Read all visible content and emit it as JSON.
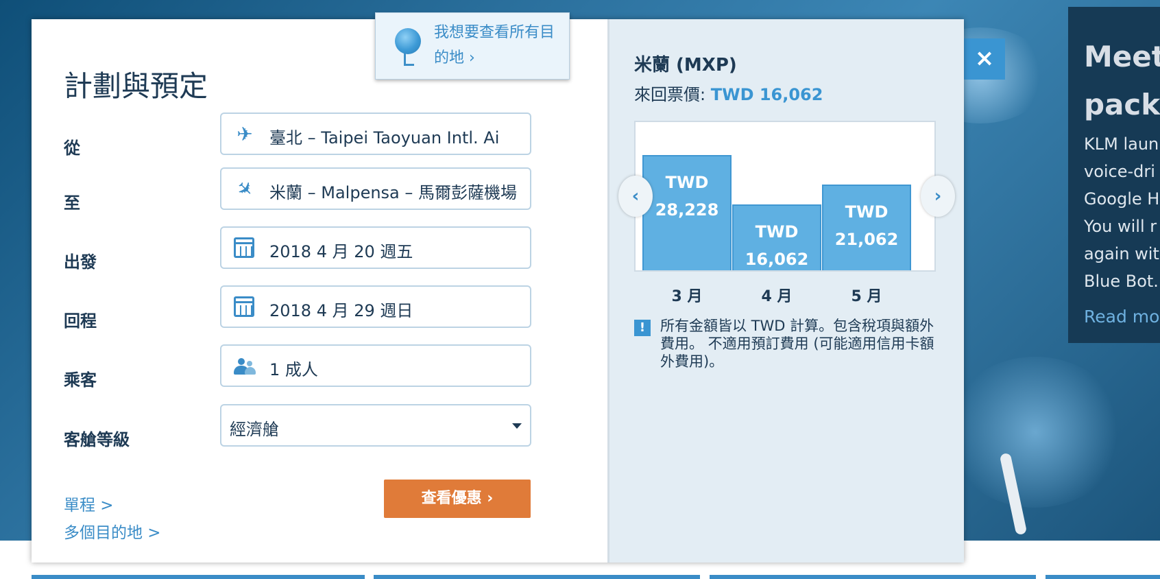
{
  "dialog": {
    "title": "計劃與預定",
    "destination_bubble": {
      "text": "我想要查看所有目的地 ›"
    },
    "fields": {
      "from": {
        "label": "從",
        "value": "臺北 – Taipei Taoyuan Intl. Ai",
        "icon": "plane-departure-icon"
      },
      "to": {
        "label": "至",
        "value": "米蘭 – Malpensa – 馬爾彭薩機場",
        "icon": "plane-arrival-icon"
      },
      "depart": {
        "label": "出發",
        "value": "2018 4 月 20 週五",
        "icon": "calendar-icon"
      },
      "return": {
        "label": "回程",
        "value": "2018 4 月 29 週日",
        "icon": "calendar-icon"
      },
      "passengers": {
        "label": "乘客",
        "value": "1 成人",
        "icon": "passengers-icon"
      },
      "cabin": {
        "label": "客艙等級",
        "value": "經濟艙"
      }
    },
    "links": {
      "one_way": "單程 >",
      "multi_city": "多個目的地 >"
    },
    "cta": "查看優惠 ›",
    "close": "×"
  },
  "fare_panel": {
    "city": "米蘭 (MXP)",
    "fare_label": "來回票價: ",
    "fare_amount": "TWD 16,062",
    "note": "所有金額皆以 TWD 計算。包含稅項與額外費用。 不適用預訂費用 (可能適用信用卡額外費用)。",
    "info_icon": "!",
    "nav_prev": "‹",
    "nav_next": "›"
  },
  "chart_data": {
    "type": "bar",
    "categories": [
      "3 月",
      "4 月",
      "5 月"
    ],
    "values": [
      28228,
      16062,
      21062
    ],
    "labels": [
      "TWD 28,228",
      "TWD 16,062",
      "TWD 21,062"
    ],
    "bar_label_currency": "TWD",
    "bar_label_values": [
      "28,228",
      "16,062",
      "21,062"
    ],
    "colors": {
      "bar": "#5fb0e2"
    }
  },
  "promo": {
    "heading": "Meet\npack",
    "body": "KLM laun\nvoice-dri\nGoogle H\nYou will r\nagain wit\nBlue Bot.",
    "read_more": "Read mo"
  },
  "colors": {
    "accent": "#3a8cc7",
    "cta": "#e07b39",
    "text": "#1e3a54"
  }
}
